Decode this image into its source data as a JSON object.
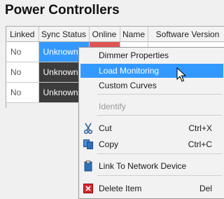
{
  "page": {
    "title": "Power Controllers"
  },
  "table": {
    "columns": [
      "Linked",
      "Sync Status",
      "Online",
      "Name",
      "Software Version"
    ],
    "rows": [
      {
        "linked": "No",
        "sync": "Unknown"
      },
      {
        "linked": "No",
        "sync": "Unknown"
      },
      {
        "linked": "No",
        "sync": "Unknown"
      }
    ]
  },
  "context_menu": {
    "items": [
      {
        "label": "Dimmer Properties"
      },
      {
        "label": "Load Monitoring",
        "highlighted": true
      },
      {
        "label": "Custom Curves"
      },
      {
        "label": "Identify",
        "disabled": true
      },
      {
        "label": "Cut",
        "shortcut": "Ctrl+X",
        "icon": "scissors-icon"
      },
      {
        "label": "Copy",
        "shortcut": "Ctrl+C",
        "icon": "copy-icon"
      },
      {
        "label": "Link To Network Device",
        "icon": "clipboard-icon"
      },
      {
        "label": "Delete Item",
        "shortcut": "Del",
        "icon": "delete-icon"
      }
    ]
  },
  "colors": {
    "selection": "#3399ff",
    "sync_unknown_bg": "#3c3c3c",
    "online_offline_bg": "#e05454"
  }
}
